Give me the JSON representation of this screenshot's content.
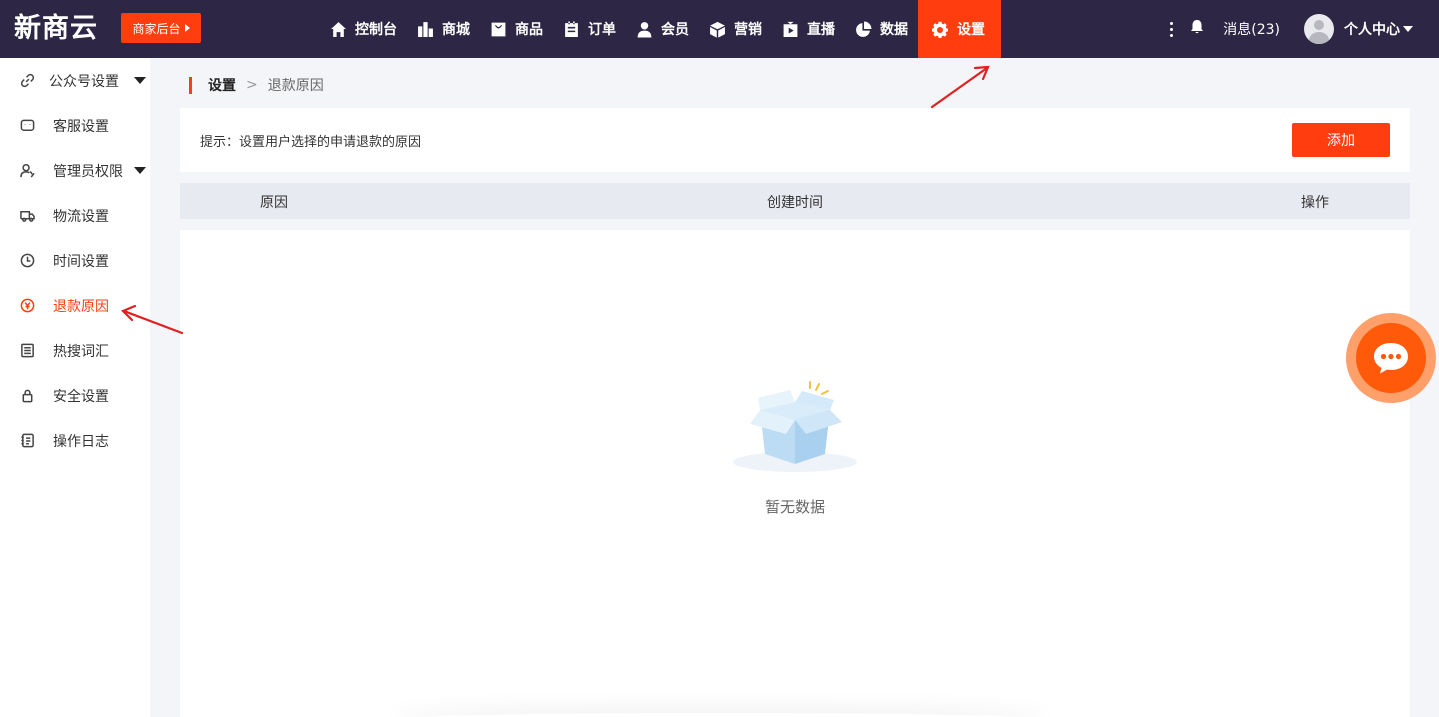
{
  "header": {
    "logo_text": "新商云",
    "merchant_label": "商家后台",
    "nav": [
      {
        "label": "控制台",
        "icon": "home-icon"
      },
      {
        "label": "商城",
        "icon": "building-icon"
      },
      {
        "label": "商品",
        "icon": "bag-icon"
      },
      {
        "label": "订单",
        "icon": "order-icon"
      },
      {
        "label": "会员",
        "icon": "user-icon"
      },
      {
        "label": "营销",
        "icon": "cube-icon"
      },
      {
        "label": "直播",
        "icon": "live-icon"
      },
      {
        "label": "数据",
        "icon": "pie-icon"
      },
      {
        "label": "设置",
        "icon": "gear-icon",
        "active": true
      }
    ],
    "messages_label": "消息(23)",
    "user_center_label": "个人中心"
  },
  "sidebar": {
    "items": [
      {
        "label": "公众号设置",
        "icon": "link-icon",
        "expandable": true
      },
      {
        "label": "客服设置",
        "icon": "chat-icon"
      },
      {
        "label": "管理员权限",
        "icon": "admin-icon",
        "expandable": true
      },
      {
        "label": "物流设置",
        "icon": "truck-icon"
      },
      {
        "label": "时间设置",
        "icon": "clock-icon"
      },
      {
        "label": "退款原因",
        "icon": "refund-icon",
        "active": true
      },
      {
        "label": "热搜词汇",
        "icon": "list-icon"
      },
      {
        "label": "安全设置",
        "icon": "lock-icon"
      },
      {
        "label": "操作日志",
        "icon": "log-icon"
      }
    ]
  },
  "breadcrumb": {
    "current": "设置",
    "separator": ">",
    "sub": "退款原因"
  },
  "tip": {
    "text": "提示：设置用户选择的申请退款的原因",
    "add_label": "添加"
  },
  "table": {
    "columns": [
      "原因",
      "创建时间",
      "操作"
    ],
    "rows": [],
    "empty_text": "暂无数据"
  },
  "colors": {
    "accent": "#ff3d0f",
    "topbar": "#2d2745",
    "table_header": "#e8eaf1",
    "fab": "#ff5a0a"
  }
}
